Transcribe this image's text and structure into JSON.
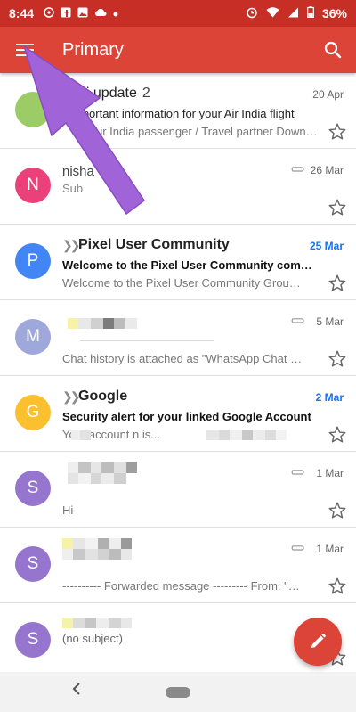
{
  "status_bar": {
    "time": "8:44",
    "battery": "36%"
  },
  "app_bar": {
    "title": "Primary"
  },
  "emails": [
    {
      "avatar_letter": "",
      "avatar_color": "#9ccc65",
      "sender": "ai.update",
      "count": "2",
      "date": "20 Apr",
      "subject": "mportant information for your Air India flight",
      "snippet": "ear Air India passenger / Travel partner Downl...",
      "unread": false
    },
    {
      "avatar_letter": "N",
      "avatar_color": "#ec407a",
      "sender": "nisha",
      "date": "26 Mar",
      "subject": "Sub",
      "snippet": "",
      "attachment": true,
      "unread": false
    },
    {
      "avatar_letter": "P",
      "avatar_color": "#4285f4",
      "sender": "Pixel User Community",
      "date": "25 Mar",
      "subject": "Welcome to the Pixel User Community comm...",
      "snippet": "Welcome to the Pixel User Community Group W...",
      "unread": true,
      "important": true
    },
    {
      "avatar_letter": "M",
      "avatar_color": "#9fa8da",
      "sender": "",
      "date": "5 Mar",
      "subject": "",
      "snippet": "Chat history is attached as \"WhatsApp Chat wit...",
      "attachment": true,
      "unread": false
    },
    {
      "avatar_letter": "G",
      "avatar_color": "#fbc02d",
      "sender": "Google",
      "date": "2 Mar",
      "subject": "Security alert for your linked Google Account",
      "snippet": "Your account n                    is...",
      "unread": true,
      "important": true
    },
    {
      "avatar_letter": "S",
      "avatar_color": "#9575cd",
      "sender": "",
      "date": "1 Mar",
      "subject": "",
      "snippet": "Hi",
      "attachment": true,
      "unread": false
    },
    {
      "avatar_letter": "S",
      "avatar_color": "#9575cd",
      "sender": "",
      "date": "1 Mar",
      "subject": "",
      "snippet": "---------- Forwarded message --------- From: \"Siya...",
      "attachment": true,
      "unread": false
    },
    {
      "avatar_letter": "S",
      "avatar_color": "#9575cd",
      "sender": "",
      "date": "",
      "subject": "(no subject)",
      "snippet": "",
      "unread": false
    }
  ],
  "colors": {
    "status_bar": "#c62e26",
    "app_bar": "#db4437",
    "date_unread": "#1a73e8",
    "arrow": "#a064d8"
  }
}
